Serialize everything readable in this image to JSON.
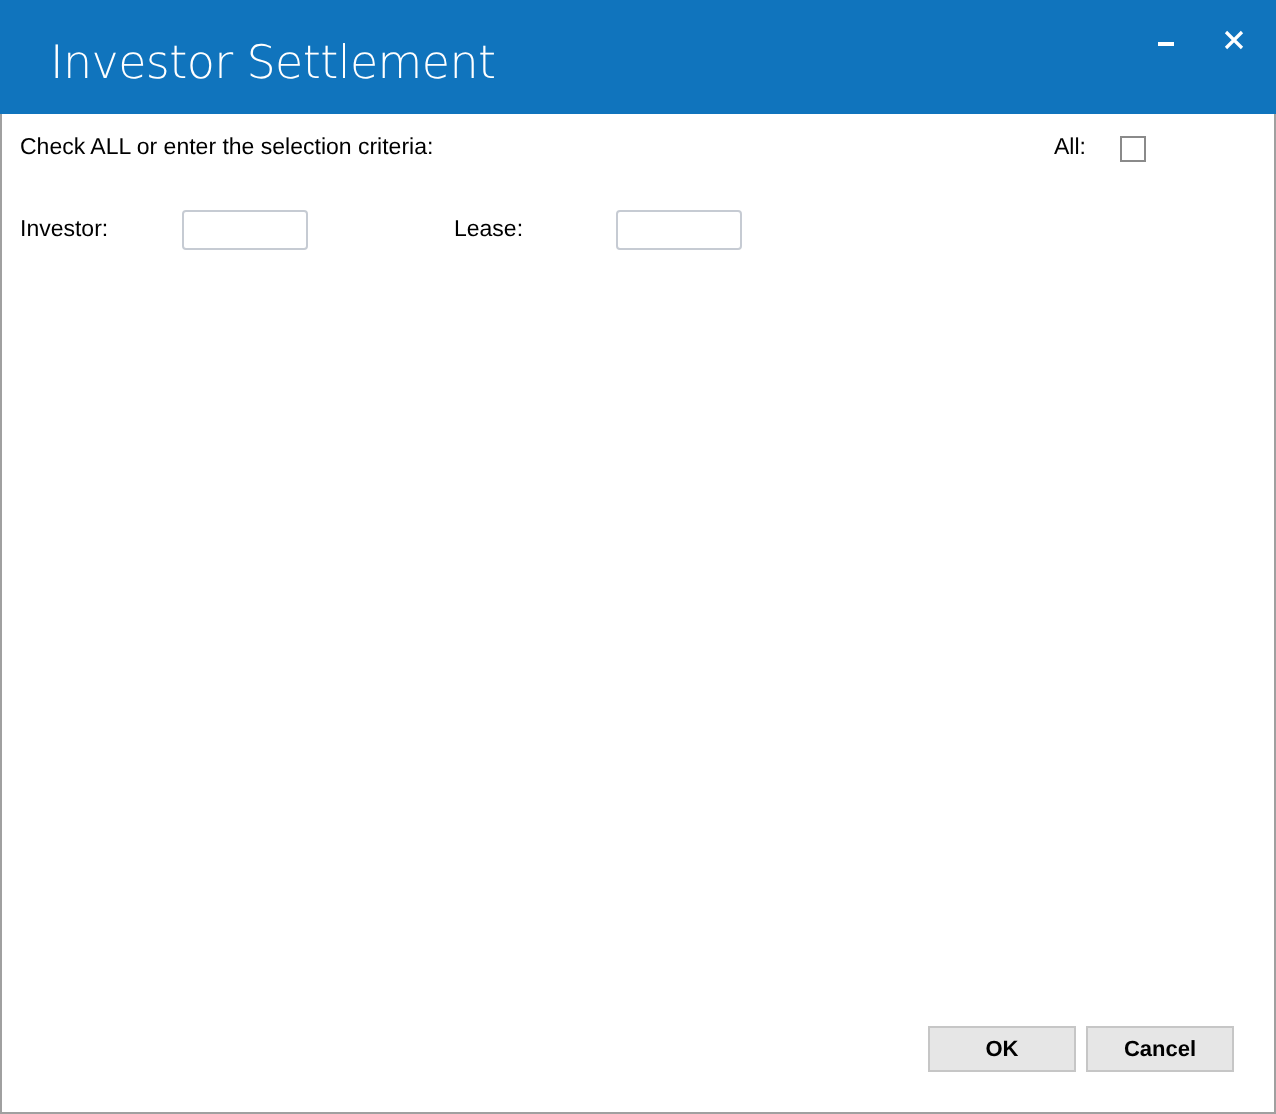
{
  "window": {
    "title": "Investor Settlement",
    "controls": [
      {
        "kind": "minimize"
      },
      {
        "kind": "close"
      }
    ]
  },
  "instruction": "Check ALL or enter the selection criteria:",
  "all": {
    "label": "All:",
    "checked": false
  },
  "fields": [
    {
      "label": "Investor:"
    },
    {
      "label": "Lease:"
    }
  ],
  "buttons": [
    {
      "label": "OK"
    },
    {
      "label": "Cancel"
    }
  ]
}
